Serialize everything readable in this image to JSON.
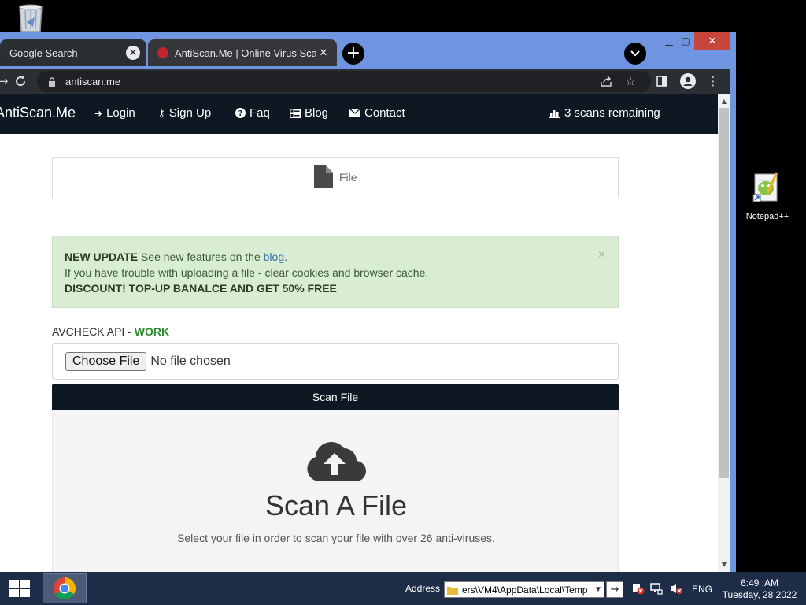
{
  "desktop": {
    "icons": [
      {
        "name": "recycle-bin",
        "label": ""
      },
      {
        "name": "notepad-plus-plus",
        "label": "Notepad++"
      }
    ]
  },
  "browser": {
    "tabs": [
      {
        "title": "- Google Search",
        "active": false
      },
      {
        "title": "AntiScan.Me | Online Virus Scanner",
        "active": true
      }
    ],
    "new_tab_symbol": "+",
    "url": "antiscan.me"
  },
  "site": {
    "brand": "AntiScan.Me",
    "nav": [
      {
        "label": "Login",
        "icon": "sign-in-icon"
      },
      {
        "label": "Sign Up",
        "icon": "key-icon"
      },
      {
        "label": "Faq",
        "icon": "question-icon"
      },
      {
        "label": "Blog",
        "icon": "blog-icon"
      },
      {
        "label": "Contact",
        "icon": "envelope-icon"
      }
    ],
    "scans_remaining": "3 scans remaining",
    "file_tab_label": "File",
    "alert": {
      "line1_bold": "NEW UPDATE",
      "line1_text": "See new features on the",
      "line1_link": "blog",
      "line2": "If you have trouble with uploading a file - clear cookies and browser cache.",
      "line3_bold": "DISCOUNT! TOP-UP BANALCE AND GET 50% FREE",
      "close": "×"
    },
    "api_label": "AVCHECK API -",
    "api_status": "WORK",
    "choose_file_label": "Choose File",
    "no_file_text": "No file chosen",
    "scan_button": "Scan File",
    "dropzone_title": "Scan A File",
    "dropzone_sub": "Select your file in order to scan your file with over 26 anti-viruses."
  },
  "taskbar": {
    "address_label": "Address",
    "address_value": "ers\\VM4\\AppData\\Local\\Temp",
    "language": "ENG",
    "time": "6:49 :AM",
    "date": "Tuesday, 28 2022"
  },
  "colors": {
    "navbar": "#0e1822",
    "alert_bg": "#d9ecd4",
    "work_green": "#2e8a2e",
    "titlebar": "#6f94e0",
    "taskbar": "#1d2d47"
  }
}
